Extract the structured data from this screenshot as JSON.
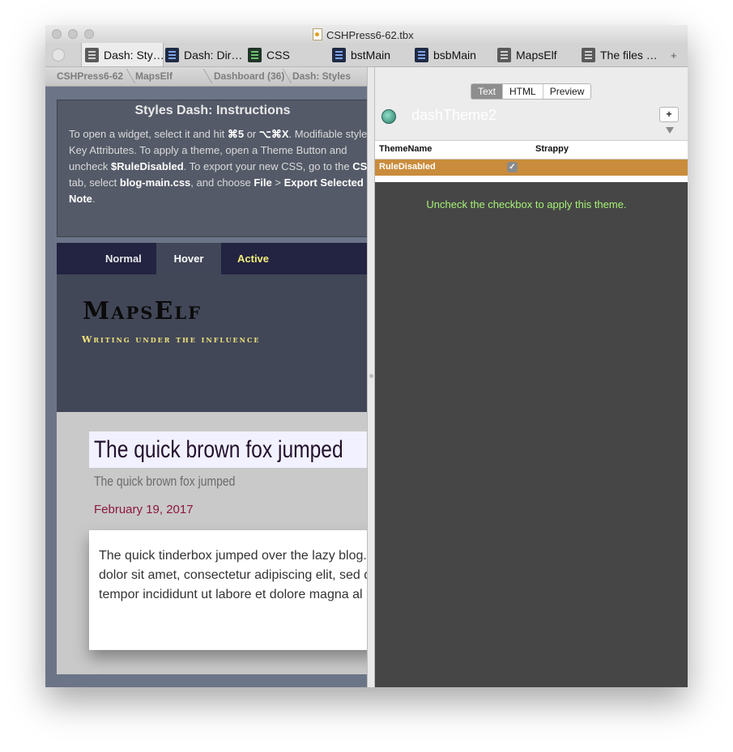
{
  "window": {
    "title": "CSHPress6-62.tbx"
  },
  "tabs": [
    {
      "label": "Dash: Sty…",
      "icon": "note-badge-icon"
    },
    {
      "label": "Dash: Dir…",
      "icon": "outline-icon"
    },
    {
      "label": "CSS",
      "icon": "outline-icon"
    },
    {
      "label": "bstMain",
      "icon": "outline-icon"
    },
    {
      "label": "bsbMain",
      "icon": "outline-icon"
    },
    {
      "label": "MapsElf",
      "icon": "outline-icon"
    },
    {
      "label": "The files …",
      "icon": "outline-icon"
    }
  ],
  "tab_add": "+",
  "breadcrumbs": [
    "CSHPress6-62",
    "MapsElf",
    "Dashboard (36)",
    "Dash: Styles"
  ],
  "instructions": {
    "title": "Styles Dash: Instructions",
    "lines": [
      [
        "To open a widget, select it and hit ",
        "⌘5",
        " or ",
        "⌥⌘X",
        ". Modifiable styles"
      ],
      [
        "Key Attributes. To apply a theme,  open a Theme Button and"
      ],
      [
        "uncheck ",
        "$RuleDisabled",
        ". To export your new CSS, go to the ",
        "CS"
      ],
      [
        "tab, select ",
        "blog-main.css",
        ", and choose ",
        "File",
        " > ",
        "Export Selected"
      ],
      [
        "Note",
        "."
      ]
    ]
  },
  "preview": {
    "nav": [
      "Normal",
      "Hover",
      "Active"
    ],
    "brand": "MapsElf",
    "tagline": "Writing under the influence",
    "post_title": "The quick brown fox jumped",
    "post_subtitle": "The quick brown fox jumped",
    "post_date": "February 19, 2017",
    "post_body": [
      "The quick tinderbox jumped over the lazy blog.",
      "dolor sit amet, consectetur adipiscing elit, sed d",
      "tempor incididunt ut labore et dolore magna al"
    ],
    "colors": {
      "nav_bg": "#232342",
      "active_text": "#f2ee7a",
      "tagline": "#efe37a",
      "date": "#8c1740"
    }
  },
  "right": {
    "view_modes": [
      "Text",
      "HTML",
      "Preview"
    ],
    "selected_view": "Text",
    "note_name": "dashTheme2",
    "add_button": "+",
    "attributes": {
      "headers": [
        "ThemeName",
        "Strappy"
      ],
      "rows": [
        {
          "name": "RuleDisabled",
          "checked": true,
          "check_glyph": "✓"
        }
      ]
    },
    "text_message": "Uncheck the checkbox to apply this theme.",
    "colors": {
      "row_highlight": "#c98c3c",
      "message": "#a6f075",
      "text_bg": "#464646"
    }
  }
}
